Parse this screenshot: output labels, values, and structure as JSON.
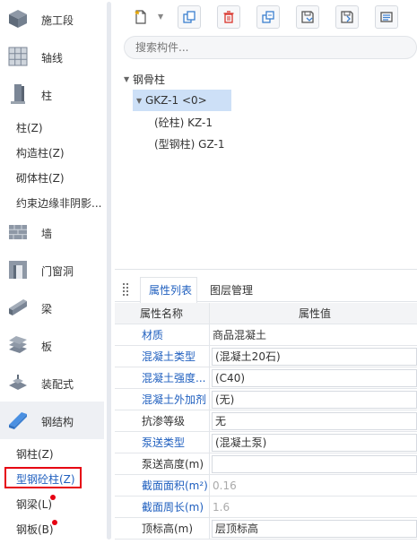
{
  "sidebar": {
    "categories_top": [
      {
        "label": "施工段",
        "icon": "construction-section-icon"
      },
      {
        "label": "轴线",
        "icon": "grid-axis-icon"
      },
      {
        "label": "柱",
        "icon": "column-icon"
      }
    ],
    "column_subitems": [
      "柱(Z)",
      "构造柱(Z)",
      "砌体柱(Z)",
      "约束边缘非阴影..."
    ],
    "categories_mid": [
      {
        "label": "墙",
        "icon": "wall-icon"
      },
      {
        "label": "门窗洞",
        "icon": "door-window-icon"
      },
      {
        "label": "梁",
        "icon": "beam-icon"
      },
      {
        "label": "板",
        "icon": "slab-icon"
      },
      {
        "label": "装配式",
        "icon": "prefab-icon"
      },
      {
        "label": "钢结构",
        "icon": "steel-structure-icon"
      }
    ],
    "steel_subitems": [
      "钢柱(Z)",
      "型钢砼柱(Z)",
      "钢梁(L)",
      "钢板(B)"
    ]
  },
  "search": {
    "placeholder": "搜索构件..."
  },
  "tree": {
    "root": "钢骨柱",
    "child": "GKZ-1 <0>",
    "leaf1": "(砼柱) KZ-1",
    "leaf2": "(型钢柱) GZ-1"
  },
  "props": {
    "tab_active": "属性列表",
    "tab_other": "图层管理",
    "header_name": "属性名称",
    "header_value": "属性值",
    "rows": [
      {
        "name": "材质",
        "value": "商品混凝土"
      },
      {
        "name": "混凝土类型",
        "value": "(混凝土20石)"
      },
      {
        "name": "混凝土强度...",
        "value": "(C40)"
      },
      {
        "name": "混凝土外加剂",
        "value": "(无)"
      },
      {
        "name": "抗渗等级",
        "value": "无"
      },
      {
        "name": "泵送类型",
        "value": "(混凝土泵)"
      },
      {
        "name": "泵送高度(m)",
        "value": ""
      },
      {
        "name": "截面面积(m²)",
        "value": "0.16"
      },
      {
        "name": "截面周长(m)",
        "value": "1.6"
      },
      {
        "name": "顶标高(m)",
        "value": "层顶标高"
      }
    ]
  },
  "colors": {
    "accent": "#1f5fbf",
    "highlight": "#e60012",
    "selection": "#cde0f7"
  }
}
